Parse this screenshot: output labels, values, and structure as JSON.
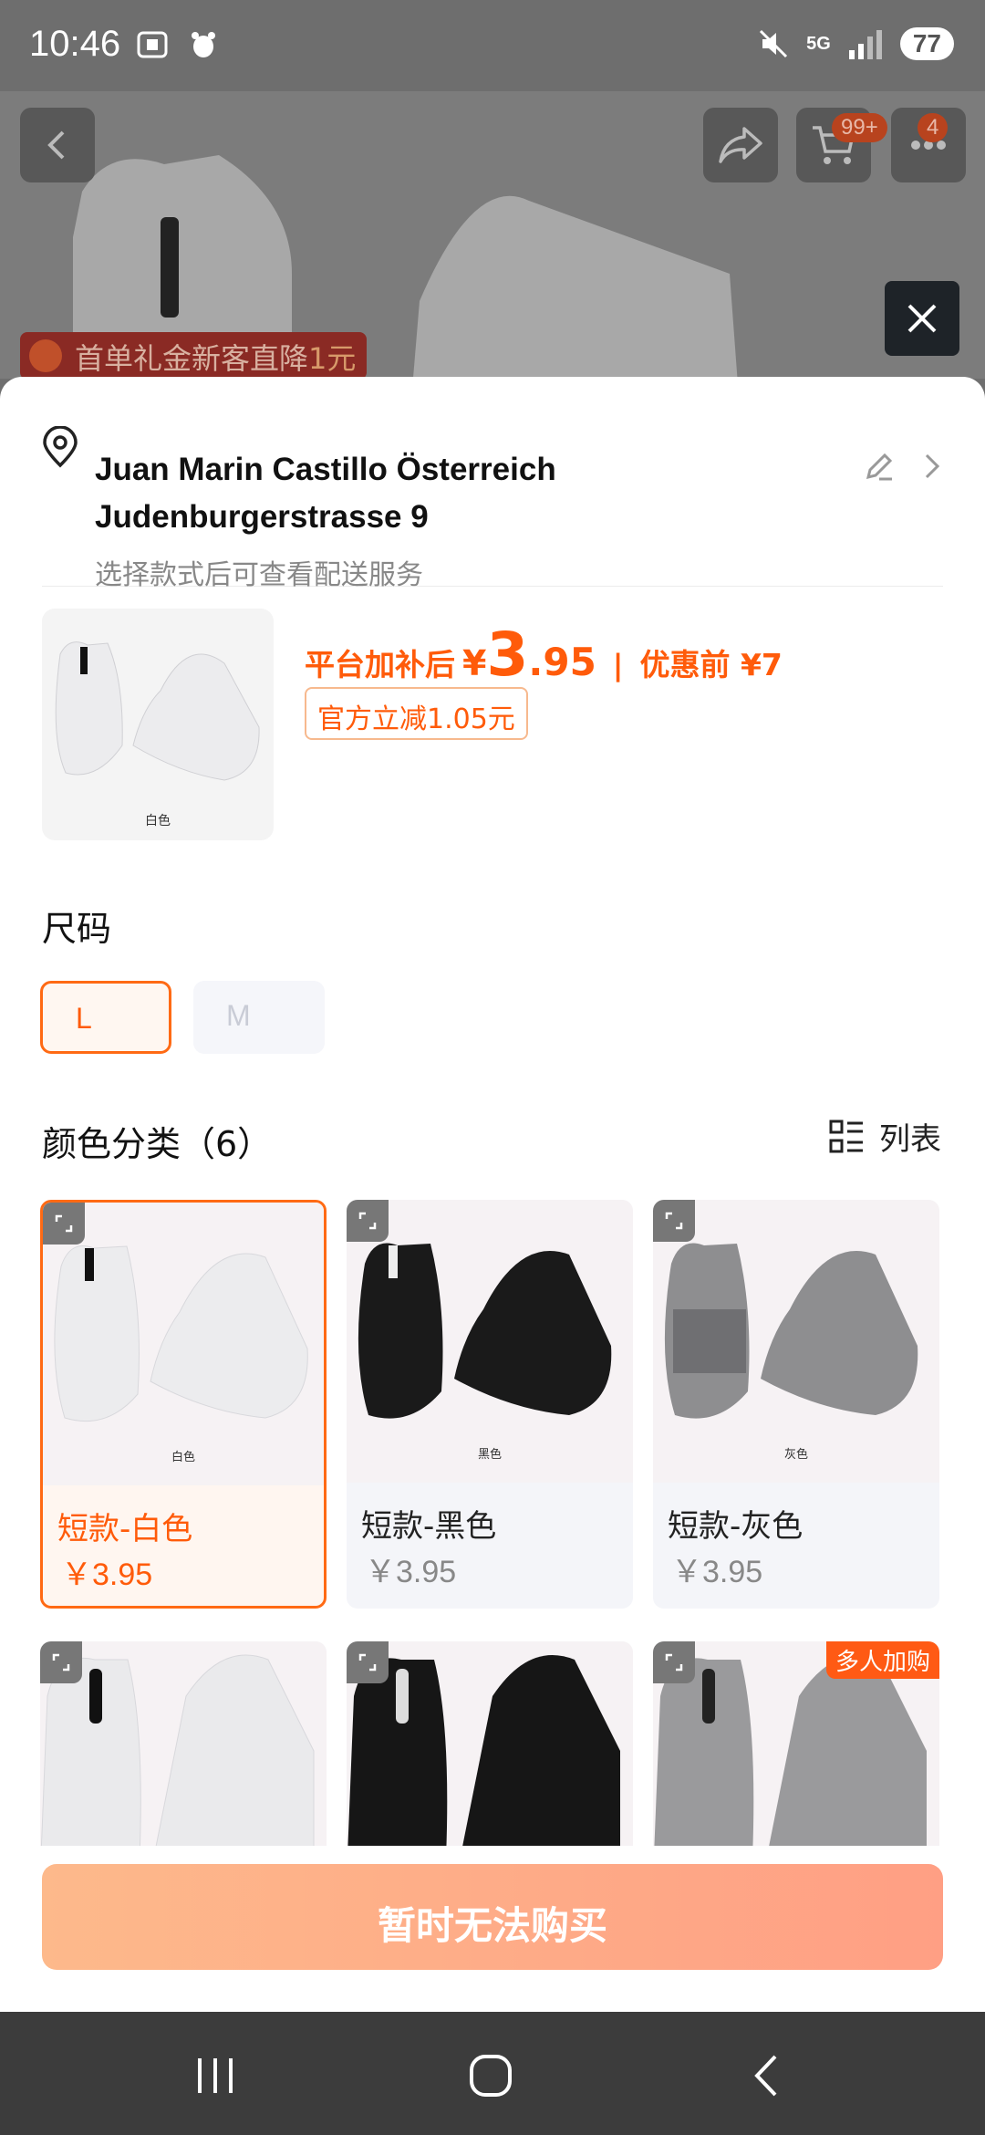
{
  "status_bar": {
    "time": "10:46",
    "network": "5G",
    "battery": "77"
  },
  "header": {
    "cart_badge": "99+",
    "more_badge": "4",
    "promo": {
      "text": "首单礼金新客直降",
      "highlight": "1元"
    }
  },
  "address": {
    "line1": "Juan Marin Castillo Österreich",
    "line2": "Judenburgerstrasse 9",
    "hint": "选择款式后可查看配送服务"
  },
  "product": {
    "thumb_caption": "白色",
    "price_label": "平台加补后",
    "currency": "¥",
    "price_int": "3",
    "price_dec": ".95",
    "separator": "|",
    "original_label": "优惠前 ¥7",
    "discount_tag": "官方立减1.05元"
  },
  "size_section": {
    "title": "尺码",
    "options": [
      {
        "label": "L",
        "selected": true
      },
      {
        "label": "M",
        "selected": false,
        "disabled": true
      }
    ]
  },
  "color_section": {
    "title": "颜色分类（6）",
    "list_toggle": "列表",
    "items": [
      {
        "name": "短款-白色",
        "price": "￥3.95",
        "caption": "白色",
        "selected": true,
        "color": "#e9e9ec"
      },
      {
        "name": "短款-黑色",
        "price": "￥3.95",
        "caption": "黑色",
        "selected": false,
        "color": "#1a1a1a"
      },
      {
        "name": "短款-灰色",
        "price": "￥3.95",
        "caption": "灰色",
        "selected": false,
        "color": "#8e8e90"
      },
      {
        "name": "",
        "price": "",
        "caption": "",
        "color": "#eaeaec"
      },
      {
        "name": "",
        "price": "",
        "caption": "",
        "color": "#161616"
      },
      {
        "name": "",
        "price": "",
        "caption": "",
        "color": "#9a9a9c",
        "tag": "多人加购"
      }
    ]
  },
  "buy_button": "暂时无法购买",
  "colors": {
    "accent": "#ff5b0a",
    "selected_border": "#ff6a14"
  }
}
